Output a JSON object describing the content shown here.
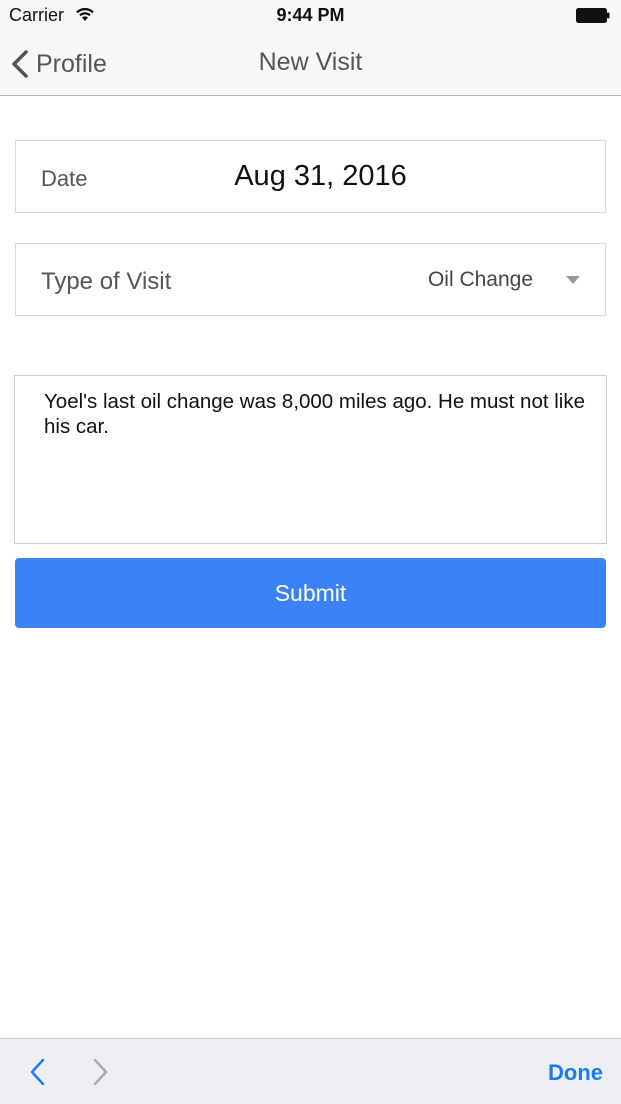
{
  "status_bar": {
    "carrier": "Carrier",
    "time": "9:44 PM"
  },
  "nav": {
    "back_label": "Profile",
    "title": "New Visit"
  },
  "form": {
    "date_label": "Date",
    "date_value": "Aug 31, 2016",
    "type_label": "Type of Visit",
    "type_value": "Oil Change",
    "notes_value": "Yoel's last oil change was 8,000 miles ago. He must not like his car.",
    "submit_label": "Submit"
  },
  "accessory_bar": {
    "done_label": "Done"
  },
  "colors": {
    "accent": "#3a82f6",
    "link": "#1a7cf0"
  }
}
